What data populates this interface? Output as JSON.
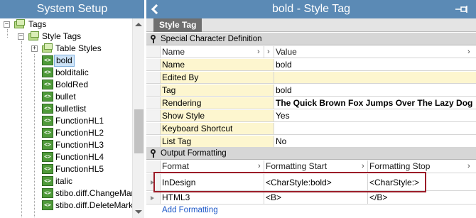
{
  "left_panel": {
    "title": "System Setup",
    "tree": {
      "root": "Tags",
      "style_tags": "Style Tags",
      "table_styles": "Table Styles",
      "items": [
        "bold",
        "bolditalic",
        "BoldRed",
        "bullet",
        "bulletlist",
        "FunctionHL1",
        "FunctionHL2",
        "FunctionHL3",
        "FunctionHL4",
        "FunctionHL5",
        "italic",
        "stibo.diff.ChangeMark",
        "stibo.diff.DeleteMarke"
      ],
      "selected": "bold"
    }
  },
  "right_panel": {
    "title": "bold - Style Tag",
    "tab": "Style Tag",
    "special_section": {
      "title": "Special Character Definition",
      "col_name": "Name",
      "col_value": "Value",
      "rows": [
        {
          "name": "Name",
          "value": "bold"
        },
        {
          "name": "Edited By",
          "value": ""
        },
        {
          "name": "Tag",
          "value": "bold"
        },
        {
          "name": "Rendering",
          "value": "The Quick Brown Fox Jumps Over The Lazy Dog"
        },
        {
          "name": "Show Style",
          "value": "Yes"
        },
        {
          "name": "Keyboard Shortcut",
          "value": ""
        },
        {
          "name": "List Tag",
          "value": "No"
        }
      ]
    },
    "output_section": {
      "title": "Output Formatting",
      "col_format": "Format",
      "col_start": "Formatting Start",
      "col_stop": "Formatting Stop",
      "rows": [
        {
          "format": "InDesign",
          "start": "<CharStyle:bold>",
          "stop": "<CharStyle:>"
        },
        {
          "format": "HTML3",
          "start": "<B>",
          "stop": "</B>"
        }
      ],
      "add_link": "Add Formatting"
    }
  },
  "colors": {
    "title_bar": "#5b8ab5",
    "highlight_border": "#9b1c28",
    "row_yellow": "#fdf6cf",
    "link": "#1a56c8"
  }
}
